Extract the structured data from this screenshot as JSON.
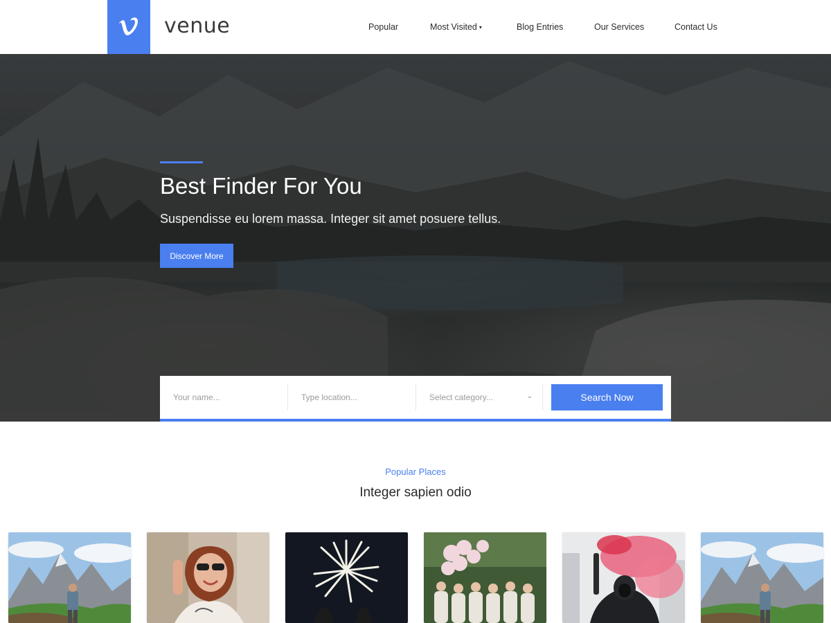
{
  "brand": {
    "name": "venue",
    "logo_letter": "v",
    "accent_color": "#4a7ff0"
  },
  "nav": {
    "items": [
      {
        "label": "Popular"
      },
      {
        "label": "Most Visited",
        "has_dropdown": true
      },
      {
        "label": "Blog Entries"
      },
      {
        "label": "Our Services"
      },
      {
        "label": "Contact Us"
      }
    ],
    "dropdown_caret": "▾"
  },
  "hero": {
    "title": "Best Finder For You",
    "subtitle": "Suspendisse eu lorem massa. Integer sit amet posuere tellus.",
    "cta_label": "Discover More"
  },
  "search": {
    "name_placeholder": "Your name...",
    "location_placeholder": "Type location...",
    "category_placeholder": "Select category...",
    "chevron": "⌄",
    "submit_label": "Search Now"
  },
  "popular": {
    "kicker": "Popular Places",
    "title": "Integer sapien odio",
    "cards": [
      {
        "image": "mountain-hiker-photo"
      },
      {
        "image": "smiling-woman-sunglasses-photo"
      },
      {
        "image": "fireworks-photo"
      },
      {
        "image": "women-with-balloons-photo"
      },
      {
        "image": "red-smoke-flare-photo"
      },
      {
        "image": "mountain-hiker-photo"
      }
    ]
  }
}
